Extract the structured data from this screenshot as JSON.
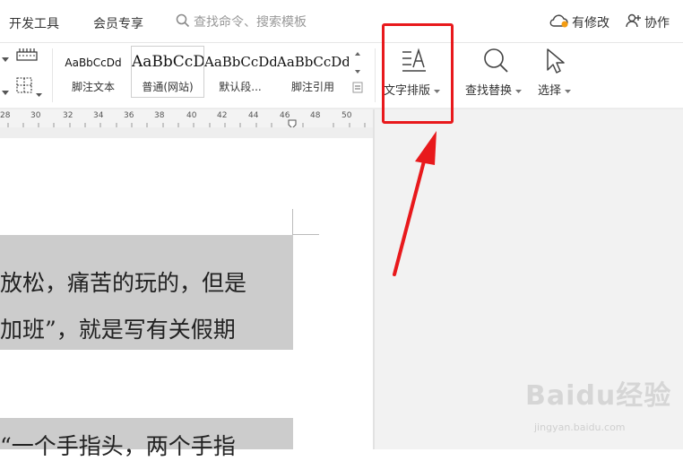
{
  "menu": {
    "tabs": [
      {
        "label": "开发工具"
      },
      {
        "label": "会员专享"
      }
    ],
    "search": {
      "placeholder": "查找命令、搜索模板"
    },
    "actions": [
      {
        "label": "有修改"
      },
      {
        "label": "协作"
      }
    ]
  },
  "ribbon": {
    "styles": [
      {
        "sample": "AaBbCcDd",
        "label": "脚注文本"
      },
      {
        "sample": "AaBbCcDd",
        "label": "普通(网站)"
      },
      {
        "sample": "AaBbCcDd",
        "label": "默认段..."
      },
      {
        "sample": "AaBbCcDd",
        "label": "脚注引用"
      }
    ],
    "tools": {
      "text_layout": "文字排版",
      "find_replace": "查找替换",
      "select": "选择"
    }
  },
  "ruler": {
    "numbers": [
      "28",
      "30",
      "32",
      "34",
      "36",
      "38",
      "40",
      "42",
      "44",
      "46",
      "48",
      "50"
    ]
  },
  "document": {
    "lines": [
      "放松，痛苦的玩的，但是",
      "加班”，就是写有关假期",
      "“一个手指头，两个手指"
    ]
  },
  "watermark": {
    "brand": "Baidu经验",
    "url": "jingyan.baidu.com"
  },
  "colors": {
    "highlight_box": "#e8191c",
    "selection": "#cccccc",
    "accent": "#333333"
  }
}
